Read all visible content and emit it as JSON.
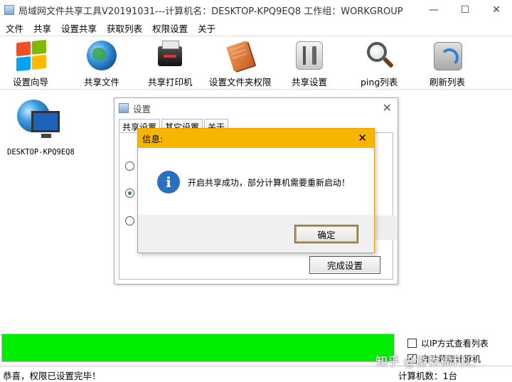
{
  "window": {
    "title": "局域网文件共享工具V20191031---计算机名：DESKTOP-KPQ9EQ8  工作组：WORKGROUP",
    "controls": [
      "—",
      "☐",
      "✕"
    ]
  },
  "menu": [
    "文件",
    "共享",
    "设置共享",
    "获取列表",
    "权限设置",
    "关于"
  ],
  "toolbar": [
    {
      "label": "设置向导",
      "icon": "windows-logo-icon"
    },
    {
      "label": "共享文件",
      "icon": "globe-icon"
    },
    {
      "label": "共享打印机",
      "icon": "printer-icon"
    },
    {
      "label": "设置文件夹权限",
      "icon": "folder-book-icon"
    },
    {
      "label": "共享设置",
      "icon": "tools-icon"
    },
    {
      "label": "ping列表",
      "icon": "magnifier-icon"
    },
    {
      "label": "刷新列表",
      "icon": "refresh-icon"
    }
  ],
  "computer": {
    "name": "DESKTOP-KPQ9EQ8"
  },
  "settings_dialog": {
    "title": "设置",
    "close": "✕",
    "tabs": [
      "共享设置",
      "其它设置",
      "关于"
    ],
    "radios": [
      false,
      true,
      false
    ],
    "finish_label": "完成设置"
  },
  "info_dialog": {
    "title": "信息:",
    "close": "✕",
    "icon_glyph": "i",
    "message": "开启共享成功，部分计算机需要重新启动！",
    "ok_label": "确定"
  },
  "progress": {
    "value": 1.0,
    "color": "#00ee00"
  },
  "options": [
    {
      "label": "以IP方式查看列表",
      "checked": false
    },
    {
      "label": "自动获取计算机",
      "checked": true
    }
  ],
  "status": {
    "message": "恭喜，权限已设置完毕！",
    "count": "计算机数：1台"
  },
  "watermark": "知乎 @游牧福利汇",
  "colors": {
    "info_titlebar": "#f7b500",
    "progress": "#00ee00",
    "info_icon": "#2b6fc3"
  }
}
